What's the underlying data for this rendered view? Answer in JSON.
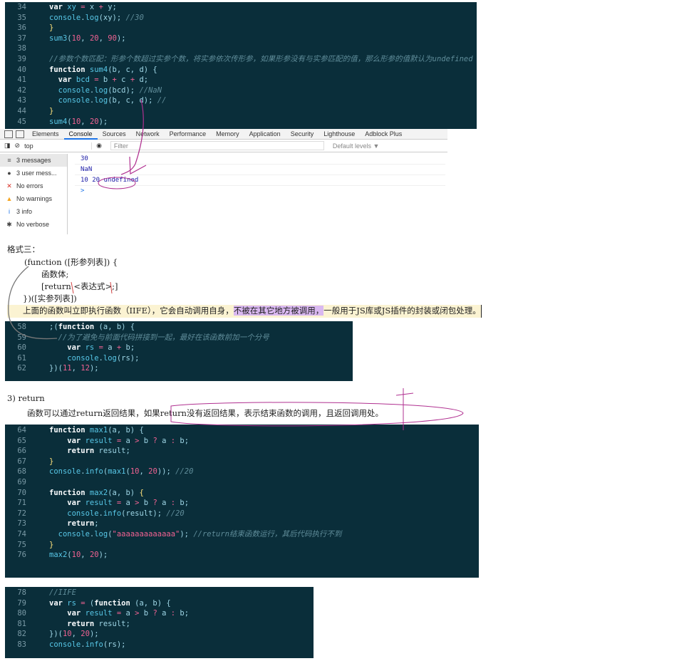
{
  "panel1": {
    "lines": [
      {
        "n": "34",
        "code": [
          [
            "var",
            "kw"
          ],
          [
            " xy ",
            "var"
          ],
          [
            "=",
            "op"
          ],
          [
            " x ",
            "plain"
          ],
          [
            "+",
            "op"
          ],
          [
            " y;",
            "plain"
          ]
        ]
      },
      {
        "n": "35",
        "code": [
          [
            "console",
            "fn"
          ],
          [
            ".",
            "plain"
          ],
          [
            "log",
            "fn"
          ],
          [
            "(xy); ",
            "plain"
          ],
          [
            "//30",
            "cmt"
          ]
        ]
      },
      {
        "n": "36",
        "code": [
          [
            "}",
            "punc"
          ]
        ]
      },
      {
        "n": "37",
        "code": [
          [
            "sum3",
            "fn"
          ],
          [
            "(",
            "plain"
          ],
          [
            "10",
            "num-lit"
          ],
          [
            ", ",
            "plain"
          ],
          [
            "20",
            "num-lit"
          ],
          [
            ", ",
            "plain"
          ],
          [
            "90",
            "num-lit"
          ],
          [
            ");",
            "plain"
          ]
        ]
      },
      {
        "n": "38",
        "code": []
      },
      {
        "n": "39",
        "code": [
          [
            "//参数个数匹配：形参个数超过实参个数，将实参依次传形参，如果形参没有与实参匹配的值，那么形参的值默认为undefined",
            "cmt"
          ]
        ]
      },
      {
        "n": "40",
        "code": [
          [
            "function",
            "kw"
          ],
          [
            " sum4",
            "fn"
          ],
          [
            "(b, c, d) {",
            "plain"
          ]
        ]
      },
      {
        "n": "41",
        "code": [
          [
            "  var",
            "kw"
          ],
          [
            " bcd ",
            "var"
          ],
          [
            "=",
            "op"
          ],
          [
            " b ",
            "plain"
          ],
          [
            "+",
            "op"
          ],
          [
            " c ",
            "plain"
          ],
          [
            "+",
            "op"
          ],
          [
            " d;",
            "plain"
          ]
        ]
      },
      {
        "n": "42",
        "code": [
          [
            "  console",
            "fn"
          ],
          [
            ".",
            "plain"
          ],
          [
            "log",
            "fn"
          ],
          [
            "(bcd); ",
            "plain"
          ],
          [
            "//NaN",
            "cmt"
          ]
        ]
      },
      {
        "n": "43",
        "code": [
          [
            "  console",
            "fn"
          ],
          [
            ".",
            "plain"
          ],
          [
            "log",
            "fn"
          ],
          [
            "(b, c, d); ",
            "plain"
          ],
          [
            "//",
            "cmt"
          ]
        ]
      },
      {
        "n": "44",
        "code": [
          [
            "}",
            "punc"
          ]
        ]
      },
      {
        "n": "45",
        "code": [
          [
            "sum4",
            "fn"
          ],
          [
            "(",
            "plain"
          ],
          [
            "10",
            "num-lit"
          ],
          [
            ", ",
            "plain"
          ],
          [
            "20",
            "num-lit"
          ],
          [
            ");",
            "plain"
          ]
        ]
      }
    ]
  },
  "devtools": {
    "tabs": [
      "Elements",
      "Console",
      "Sources",
      "Network",
      "Performance",
      "Memory",
      "Application",
      "Security",
      "Lighthouse",
      "Adblock Plus"
    ],
    "active_tab": "Console",
    "context": "top",
    "filter_placeholder": "Filter",
    "levels": "Default levels ▼",
    "sidebar": [
      {
        "label": "3 messages",
        "icon": "list-icon"
      },
      {
        "label": "3 user mess...",
        "icon": "user-icon"
      },
      {
        "label": "No errors",
        "icon": "error-icon"
      },
      {
        "label": "No warnings",
        "icon": "warning-icon"
      },
      {
        "label": "3 info",
        "icon": "info-icon"
      },
      {
        "label": "No verbose",
        "icon": "bug-icon"
      }
    ],
    "output": [
      "30",
      "NaN",
      "10 20 undefined"
    ],
    "prompt": ">"
  },
  "doc1": {
    "heading": "格式三：",
    "l1": "(function ([形参列表]) {",
    "l2": "函数体;",
    "l3": "[return <表达式>;]",
    "l4": "})([实参列表])",
    "note_a": "上面的函数叫立即执行函数（IIFE），它会自动调用自身，",
    "note_b": "不被在其它地方被调用，",
    "note_c": "一般用于JS库或JS插件的封装或闭包处理。"
  },
  "panel2": {
    "lines": [
      {
        "n": "58",
        "code": [
          [
            ";(",
            "plain"
          ],
          [
            "function",
            "kw"
          ],
          [
            " (a, b) {",
            "plain"
          ]
        ]
      },
      {
        "n": "59",
        "code": [
          [
            "  //为了避免与前面代码拼接到一起，最好在该函数前加一个分号",
            "cmt"
          ]
        ]
      },
      {
        "n": "60",
        "code": [
          [
            "    var",
            "kw"
          ],
          [
            " rs ",
            "var"
          ],
          [
            "=",
            "op"
          ],
          [
            " a ",
            "plain"
          ],
          [
            "+",
            "op"
          ],
          [
            " b;",
            "plain"
          ]
        ]
      },
      {
        "n": "61",
        "code": [
          [
            "    console",
            "fn"
          ],
          [
            ".",
            "plain"
          ],
          [
            "log",
            "fn"
          ],
          [
            "(rs);",
            "plain"
          ]
        ]
      },
      {
        "n": "62",
        "code": [
          [
            "})(",
            "plain"
          ],
          [
            "11",
            "num-lit"
          ],
          [
            ", ",
            "plain"
          ],
          [
            "12",
            "num-lit"
          ],
          [
            ");",
            "plain"
          ]
        ]
      }
    ]
  },
  "doc2": {
    "heading": "3) return",
    "body": "函数可以通过return返回结果，如果return没有返回结果，表示结束函数的调用，且返回调用处。"
  },
  "panel3": {
    "lines": [
      {
        "n": "64",
        "code": [
          [
            "function",
            "kw"
          ],
          [
            " max1",
            "fn"
          ],
          [
            "(a, b) {",
            "plain"
          ]
        ]
      },
      {
        "n": "65",
        "code": [
          [
            "    var",
            "kw"
          ],
          [
            " result ",
            "var"
          ],
          [
            "=",
            "op"
          ],
          [
            " a ",
            "plain"
          ],
          [
            ">",
            "op"
          ],
          [
            " b ",
            "plain"
          ],
          [
            "?",
            "op"
          ],
          [
            " a ",
            "plain"
          ],
          [
            ":",
            "op"
          ],
          [
            " b;",
            "plain"
          ]
        ]
      },
      {
        "n": "66",
        "code": [
          [
            "    return",
            "kw"
          ],
          [
            " result;",
            "plain"
          ]
        ]
      },
      {
        "n": "67",
        "code": [
          [
            "}",
            "punc"
          ]
        ]
      },
      {
        "n": "68",
        "code": [
          [
            "console",
            "fn"
          ],
          [
            ".",
            "plain"
          ],
          [
            "info",
            "fn"
          ],
          [
            "(",
            "plain"
          ],
          [
            "max1",
            "fn"
          ],
          [
            "(",
            "plain"
          ],
          [
            "10",
            "num-lit"
          ],
          [
            ", ",
            "plain"
          ],
          [
            "20",
            "num-lit"
          ],
          [
            "));",
            "plain"
          ],
          [
            " //20",
            "cmt"
          ]
        ]
      },
      {
        "n": "69",
        "code": []
      },
      {
        "n": "70",
        "code": [
          [
            "function",
            "kw"
          ],
          [
            " max2",
            "fn"
          ],
          [
            "(a, b) ",
            "plain"
          ],
          [
            "{",
            "punc"
          ]
        ]
      },
      {
        "n": "71",
        "code": [
          [
            "    var",
            "kw"
          ],
          [
            " result ",
            "var"
          ],
          [
            "=",
            "op"
          ],
          [
            " a ",
            "plain"
          ],
          [
            ">",
            "op"
          ],
          [
            " b ",
            "plain"
          ],
          [
            "?",
            "op"
          ],
          [
            " a ",
            "plain"
          ],
          [
            ":",
            "op"
          ],
          [
            " b;",
            "plain"
          ]
        ]
      },
      {
        "n": "72",
        "code": [
          [
            "    console",
            "fn"
          ],
          [
            ".",
            "plain"
          ],
          [
            "info",
            "fn"
          ],
          [
            "(result); ",
            "plain"
          ],
          [
            "//20",
            "cmt"
          ]
        ]
      },
      {
        "n": "73",
        "code": [
          [
            "    return",
            "kw"
          ],
          [
            ";",
            "plain"
          ]
        ]
      },
      {
        "n": "74",
        "code": [
          [
            "  console",
            "fn"
          ],
          [
            ".",
            "plain"
          ],
          [
            "log",
            "fn"
          ],
          [
            "(",
            "plain"
          ],
          [
            "\"aaaaaaaaaaaaa\"",
            "str"
          ],
          [
            "); ",
            "plain"
          ],
          [
            "//return结束函数运行，其后代码执行不到",
            "cmt"
          ]
        ]
      },
      {
        "n": "75",
        "code": [
          [
            "}",
            "punc"
          ]
        ]
      },
      {
        "n": "76",
        "code": [
          [
            "max2",
            "fn"
          ],
          [
            "(",
            "plain"
          ],
          [
            "10",
            "num-lit"
          ],
          [
            ", ",
            "plain"
          ],
          [
            "20",
            "num-lit"
          ],
          [
            ");",
            "plain"
          ]
        ]
      }
    ]
  },
  "panel4": {
    "lines": [
      {
        "n": "78",
        "code": [
          [
            "//IIFE",
            "cmt"
          ]
        ]
      },
      {
        "n": "79",
        "code": [
          [
            "var",
            "kw"
          ],
          [
            " rs ",
            "var"
          ],
          [
            "=",
            "op"
          ],
          [
            " (",
            "plain"
          ],
          [
            "function",
            "kw"
          ],
          [
            " (a, b) {",
            "plain"
          ]
        ]
      },
      {
        "n": "80",
        "code": [
          [
            "    var",
            "kw"
          ],
          [
            " result ",
            "var"
          ],
          [
            "=",
            "op"
          ],
          [
            " a ",
            "plain"
          ],
          [
            ">",
            "op"
          ],
          [
            " b ",
            "plain"
          ],
          [
            "?",
            "op"
          ],
          [
            " a ",
            "plain"
          ],
          [
            ":",
            "op"
          ],
          [
            " b;",
            "plain"
          ]
        ]
      },
      {
        "n": "81",
        "code": [
          [
            "    return",
            "kw"
          ],
          [
            " result;",
            "plain"
          ]
        ]
      },
      {
        "n": "82",
        "code": [
          [
            "})(",
            "plain"
          ],
          [
            "10",
            "num-lit"
          ],
          [
            ", ",
            "plain"
          ],
          [
            "20",
            "num-lit"
          ],
          [
            ");",
            "plain"
          ]
        ]
      },
      {
        "n": "83",
        "code": [
          [
            "console",
            "fn"
          ],
          [
            ".",
            "plain"
          ],
          [
            "info",
            "fn"
          ],
          [
            "(rs);",
            "plain"
          ]
        ]
      }
    ]
  }
}
